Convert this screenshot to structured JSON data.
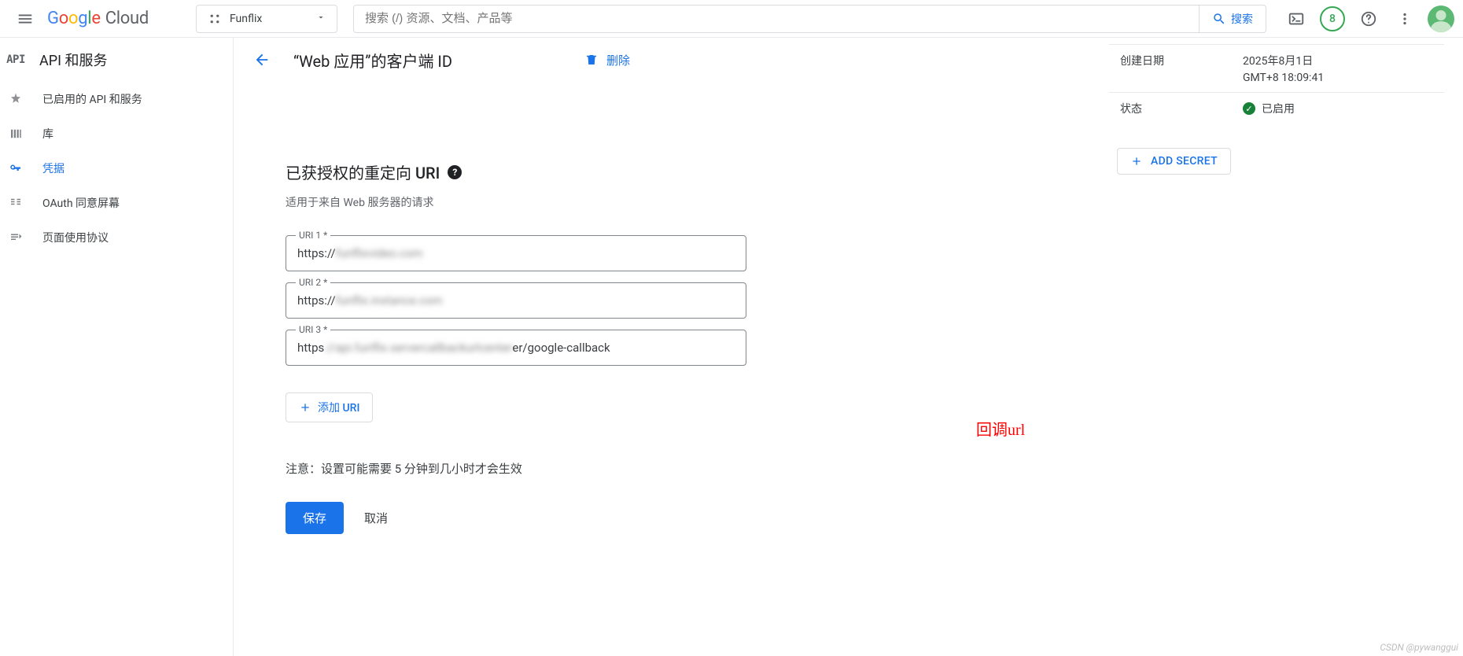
{
  "top": {
    "logo_cloud": "Cloud",
    "project_name": "Funflix",
    "search_placeholder": "搜索 (/) 资源、文档、产品等",
    "search_button": "搜索",
    "badge": "8"
  },
  "sidebar": {
    "title": "API 和服务",
    "api_logo": "API",
    "items": [
      {
        "label": "已启用的 API 和服务"
      },
      {
        "label": "库"
      },
      {
        "label": "凭据"
      },
      {
        "label": "OAuth 同意屏幕"
      },
      {
        "label": "页面使用协议"
      }
    ]
  },
  "page": {
    "title": "“Web 应用”的客户端 ID",
    "delete": "删除",
    "section_title": "已获授权的重定向 URI",
    "section_sub": "适用于来自 Web 服务器的请求",
    "fields": {
      "uri1": {
        "label": "URI 1 *",
        "prefix": "https://",
        "blur": "funflixvideo.com"
      },
      "uri2": {
        "label": "URI 2 *",
        "prefix": "https://",
        "blur": "funflix.instance.com"
      },
      "uri3": {
        "label": "URI 3 *",
        "prefix": "https",
        "blur": "://api.funflix.servercallbackurlcenter",
        "suffix": "er/google-callback"
      }
    },
    "add_uri": "添加 URI",
    "note": "注意：设置可能需要 5 分钟到几小时才会生效",
    "save": "保存",
    "cancel": "取消",
    "callback_annotation": "回调url"
  },
  "info": {
    "created_label": "创建日期",
    "created_value_line1": "2025年8月1日",
    "created_value_line2": "GMT+8 18:09:41",
    "status_label": "状态",
    "status_value": "已启用",
    "add_secret": "ADD SECRET"
  },
  "watermark": "CSDN @pywanggui"
}
